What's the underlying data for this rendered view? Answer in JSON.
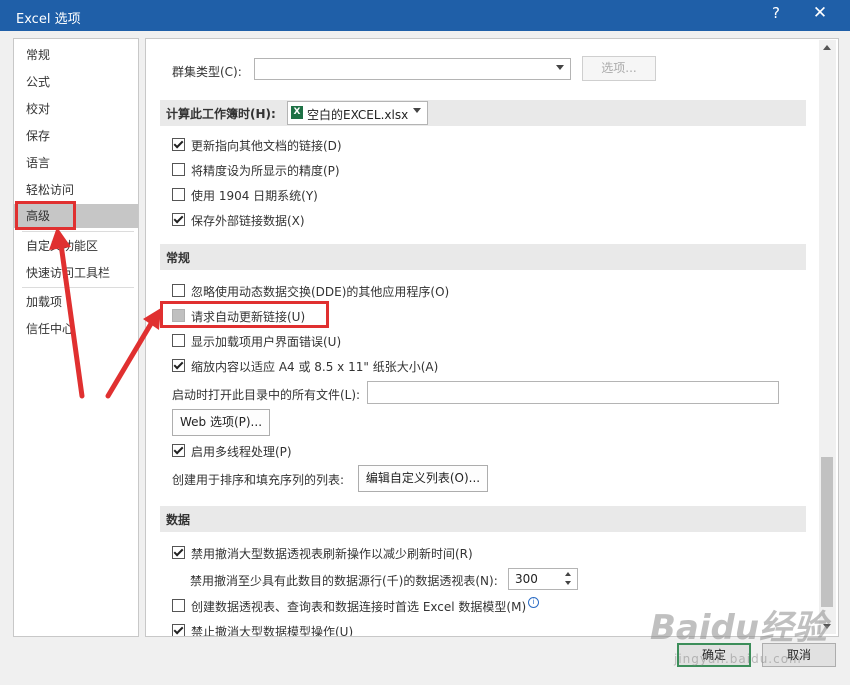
{
  "window": {
    "title": "Excel 选项",
    "help_glyph": "?",
    "close_glyph": "✕"
  },
  "nav": {
    "items": [
      {
        "label": "常规"
      },
      {
        "label": "公式"
      },
      {
        "label": "校对"
      },
      {
        "label": "保存"
      },
      {
        "label": "语言"
      },
      {
        "label": "轻松访问"
      },
      {
        "label": "高级",
        "selected": true
      },
      {
        "label": "自定义功能区"
      },
      {
        "label": "快速访问工具栏"
      },
      {
        "label": "加载项"
      },
      {
        "label": "信任中心"
      }
    ]
  },
  "cluster": {
    "label": "群集类型(C):",
    "value": "",
    "options_button": "选项..."
  },
  "calc_workbook": {
    "header": "计算此工作簿时(H):",
    "workbook": "空白的EXCEL.xlsx",
    "icon": "excel-file-icon",
    "options": [
      {
        "label": "更新指向其他文档的链接(D)",
        "checked": true
      },
      {
        "label": "将精度设为所显示的精度(P)",
        "checked": false
      },
      {
        "label": "使用 1904 日期系统(Y)",
        "checked": false
      },
      {
        "label": "保存外部链接数据(X)",
        "checked": true
      }
    ]
  },
  "general": {
    "header": "常规",
    "options": [
      {
        "label": "忽略使用动态数据交换(DDE)的其他应用程序(O)",
        "checked": false
      },
      {
        "label": "请求自动更新链接(U)",
        "checked": false,
        "disabled": true
      },
      {
        "label": "显示加载项用户界面错误(U)",
        "checked": false
      },
      {
        "label": "缩放内容以适应 A4 或 8.5 x 11\" 纸张大小(A)",
        "checked": true
      }
    ],
    "startup_label": "启动时打开此目录中的所有文件(L):",
    "startup_value": "",
    "web_options_button": "Web 选项(P)...",
    "multithread": {
      "label": "启用多线程处理(P)",
      "checked": true
    },
    "custom_lists_label": "创建用于排序和填充序列的列表:",
    "custom_lists_button": "编辑自定义列表(O)..."
  },
  "data": {
    "header": "数据",
    "undo_pivot": {
      "label": "禁用撤消大型数据透视表刷新操作以减少刷新时间(R)",
      "checked": true
    },
    "undo_rows_label": "禁用撤消至少具有此数目的数据源行(千)的数据透视表(N):",
    "undo_rows_value": "300",
    "data_model": {
      "label": "创建数据透视表、查询表和数据连接时首选 Excel 数据模型(M)",
      "checked": false
    },
    "undo_model": {
      "label": "禁止撤消大型数据模型操作(U)",
      "checked": true
    }
  },
  "footer": {
    "ok": "确定",
    "cancel": "取消"
  },
  "watermark": {
    "brand": "Baidu经验",
    "domain": "jingyan.baidu.com"
  },
  "colors": {
    "titlebar": "#1f5fa8",
    "selected_nav": "#c6c6c6",
    "highlight": "#e03030",
    "excel_green": "#1e7145"
  }
}
